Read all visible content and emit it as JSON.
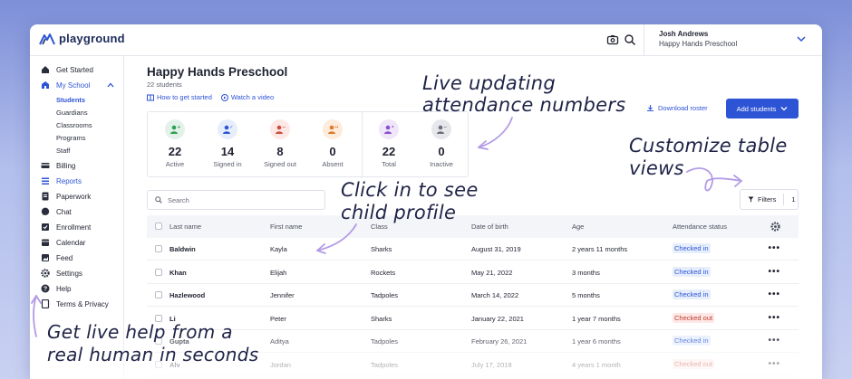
{
  "app": {
    "name": "playground"
  },
  "user": {
    "name": "Josh Andrews",
    "org": "Happy Hands Preschool"
  },
  "sidebar": {
    "items": [
      {
        "label": "Get Started",
        "icon": "home-icon"
      },
      {
        "label": "My School",
        "icon": "school-icon",
        "active": true,
        "children": [
          "Students",
          "Guardians",
          "Classrooms",
          "Programs",
          "Staff"
        ]
      },
      {
        "label": "Billing",
        "icon": "billing-icon"
      },
      {
        "label": "Reports",
        "icon": "reports-icon"
      },
      {
        "label": "Paperwork",
        "icon": "paperwork-icon"
      },
      {
        "label": "Chat",
        "icon": "chat-icon"
      },
      {
        "label": "Enrollment",
        "icon": "enrollment-icon"
      },
      {
        "label": "Calendar",
        "icon": "calendar-icon"
      },
      {
        "label": "Feed",
        "icon": "feed-icon"
      },
      {
        "label": "Settings",
        "icon": "gear-icon"
      },
      {
        "label": "Help",
        "icon": "help-icon"
      },
      {
        "label": "Terms & Privacy",
        "icon": "document-icon"
      }
    ]
  },
  "page": {
    "title": "Happy Hands Preschool",
    "subtitle": "22 students",
    "link_how": "How to get started",
    "link_video": "Watch a video",
    "download_label": "Download roster",
    "add_label": "Add students"
  },
  "stats": [
    {
      "value": "22",
      "label": "Active",
      "color": "#e3f2e8",
      "fg": "#2f9e57"
    },
    {
      "value": "14",
      "label": "Signed in",
      "color": "#e6eefc",
      "fg": "#2e54d6"
    },
    {
      "value": "8",
      "label": "Signed out",
      "color": "#fde8e6",
      "fg": "#d24b3e"
    },
    {
      "value": "0",
      "label": "Absent",
      "color": "#fdebdc",
      "fg": "#e07a2c"
    },
    {
      "value": "22",
      "label": "Total",
      "color": "#efe6fa",
      "fg": "#8a4fd1"
    },
    {
      "value": "0",
      "label": "Inactive",
      "color": "#e6e7eb",
      "fg": "#6b6f7e"
    }
  ],
  "search": {
    "placeholder": "Search"
  },
  "filters": {
    "label": "Filters",
    "count": "1"
  },
  "table": {
    "headers": [
      "Last name",
      "First name",
      "Class",
      "Date of birth",
      "Age",
      "Attendance status"
    ],
    "rows": [
      {
        "last": "Baldwin",
        "first": "Kayla",
        "class": "Sharks",
        "dob": "August 31, 2019",
        "age": "2 years 11 months",
        "status": "Checked in"
      },
      {
        "last": "Khan",
        "first": "Elijah",
        "class": "Rockets",
        "dob": "May 21, 2022",
        "age": "3 months",
        "status": "Checked in"
      },
      {
        "last": "Hazlewood",
        "first": "Jennifer",
        "class": "Tadpoles",
        "dob": "March 14, 2022",
        "age": "5 months",
        "status": "Checked in"
      },
      {
        "last": "Li",
        "first": "Peter",
        "class": "Sharks",
        "dob": "January 22, 2021",
        "age": "1 year 7 months",
        "status": "Checked out"
      },
      {
        "last": "Gupta",
        "first": "Aditya",
        "class": "Tadpoles",
        "dob": "February 26, 2021",
        "age": "1 year 6 months",
        "status": "Checked in"
      },
      {
        "last": "Alv",
        "first": "Jordan",
        "class": "Tadpoles",
        "dob": "July 17, 2018",
        "age": "4 years 1 month",
        "status": "Checked out"
      }
    ]
  },
  "annotations": {
    "live_updating": [
      "Live updating",
      "attendance numbers"
    ],
    "customize": [
      "Customize table",
      "views"
    ],
    "click_in": [
      "Click in to see",
      "child profile"
    ],
    "help": [
      "Get live help from a",
      "real human in seconds"
    ]
  },
  "colors": {
    "accent": "#2e54d6",
    "checked_in_bg": "#e6eefc",
    "checked_out_bg": "#fde8e6",
    "annotation_arrow": "#b39be6"
  }
}
